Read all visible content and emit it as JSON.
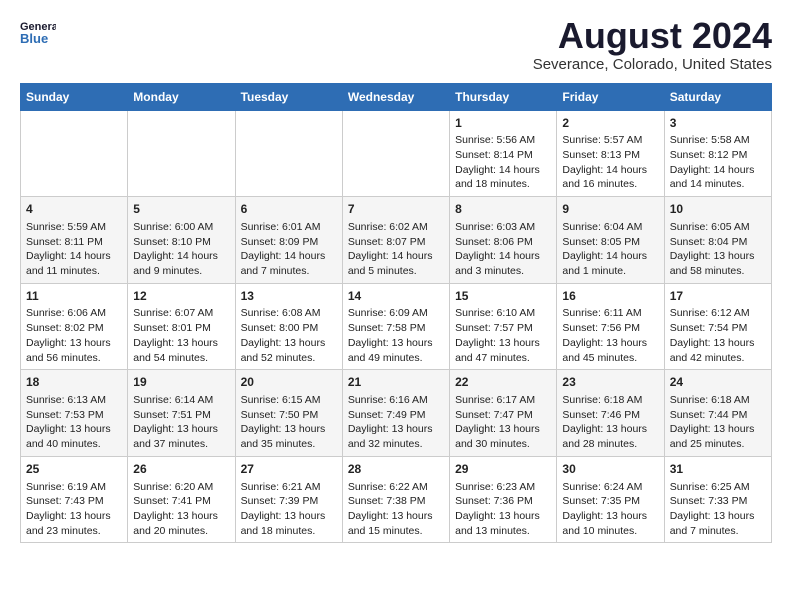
{
  "logo": {
    "line1": "General",
    "line2": "Blue"
  },
  "title": "August 2024",
  "subtitle": "Severance, Colorado, United States",
  "weekdays": [
    "Sunday",
    "Monday",
    "Tuesday",
    "Wednesday",
    "Thursday",
    "Friday",
    "Saturday"
  ],
  "weeks": [
    [
      {
        "day": "",
        "info": ""
      },
      {
        "day": "",
        "info": ""
      },
      {
        "day": "",
        "info": ""
      },
      {
        "day": "",
        "info": ""
      },
      {
        "day": "1",
        "info": "Sunrise: 5:56 AM\nSunset: 8:14 PM\nDaylight: 14 hours\nand 18 minutes."
      },
      {
        "day": "2",
        "info": "Sunrise: 5:57 AM\nSunset: 8:13 PM\nDaylight: 14 hours\nand 16 minutes."
      },
      {
        "day": "3",
        "info": "Sunrise: 5:58 AM\nSunset: 8:12 PM\nDaylight: 14 hours\nand 14 minutes."
      }
    ],
    [
      {
        "day": "4",
        "info": "Sunrise: 5:59 AM\nSunset: 8:11 PM\nDaylight: 14 hours\nand 11 minutes."
      },
      {
        "day": "5",
        "info": "Sunrise: 6:00 AM\nSunset: 8:10 PM\nDaylight: 14 hours\nand 9 minutes."
      },
      {
        "day": "6",
        "info": "Sunrise: 6:01 AM\nSunset: 8:09 PM\nDaylight: 14 hours\nand 7 minutes."
      },
      {
        "day": "7",
        "info": "Sunrise: 6:02 AM\nSunset: 8:07 PM\nDaylight: 14 hours\nand 5 minutes."
      },
      {
        "day": "8",
        "info": "Sunrise: 6:03 AM\nSunset: 8:06 PM\nDaylight: 14 hours\nand 3 minutes."
      },
      {
        "day": "9",
        "info": "Sunrise: 6:04 AM\nSunset: 8:05 PM\nDaylight: 14 hours\nand 1 minute."
      },
      {
        "day": "10",
        "info": "Sunrise: 6:05 AM\nSunset: 8:04 PM\nDaylight: 13 hours\nand 58 minutes."
      }
    ],
    [
      {
        "day": "11",
        "info": "Sunrise: 6:06 AM\nSunset: 8:02 PM\nDaylight: 13 hours\nand 56 minutes."
      },
      {
        "day": "12",
        "info": "Sunrise: 6:07 AM\nSunset: 8:01 PM\nDaylight: 13 hours\nand 54 minutes."
      },
      {
        "day": "13",
        "info": "Sunrise: 6:08 AM\nSunset: 8:00 PM\nDaylight: 13 hours\nand 52 minutes."
      },
      {
        "day": "14",
        "info": "Sunrise: 6:09 AM\nSunset: 7:58 PM\nDaylight: 13 hours\nand 49 minutes."
      },
      {
        "day": "15",
        "info": "Sunrise: 6:10 AM\nSunset: 7:57 PM\nDaylight: 13 hours\nand 47 minutes."
      },
      {
        "day": "16",
        "info": "Sunrise: 6:11 AM\nSunset: 7:56 PM\nDaylight: 13 hours\nand 45 minutes."
      },
      {
        "day": "17",
        "info": "Sunrise: 6:12 AM\nSunset: 7:54 PM\nDaylight: 13 hours\nand 42 minutes."
      }
    ],
    [
      {
        "day": "18",
        "info": "Sunrise: 6:13 AM\nSunset: 7:53 PM\nDaylight: 13 hours\nand 40 minutes."
      },
      {
        "day": "19",
        "info": "Sunrise: 6:14 AM\nSunset: 7:51 PM\nDaylight: 13 hours\nand 37 minutes."
      },
      {
        "day": "20",
        "info": "Sunrise: 6:15 AM\nSunset: 7:50 PM\nDaylight: 13 hours\nand 35 minutes."
      },
      {
        "day": "21",
        "info": "Sunrise: 6:16 AM\nSunset: 7:49 PM\nDaylight: 13 hours\nand 32 minutes."
      },
      {
        "day": "22",
        "info": "Sunrise: 6:17 AM\nSunset: 7:47 PM\nDaylight: 13 hours\nand 30 minutes."
      },
      {
        "day": "23",
        "info": "Sunrise: 6:18 AM\nSunset: 7:46 PM\nDaylight: 13 hours\nand 28 minutes."
      },
      {
        "day": "24",
        "info": "Sunrise: 6:18 AM\nSunset: 7:44 PM\nDaylight: 13 hours\nand 25 minutes."
      }
    ],
    [
      {
        "day": "25",
        "info": "Sunrise: 6:19 AM\nSunset: 7:43 PM\nDaylight: 13 hours\nand 23 minutes."
      },
      {
        "day": "26",
        "info": "Sunrise: 6:20 AM\nSunset: 7:41 PM\nDaylight: 13 hours\nand 20 minutes."
      },
      {
        "day": "27",
        "info": "Sunrise: 6:21 AM\nSunset: 7:39 PM\nDaylight: 13 hours\nand 18 minutes."
      },
      {
        "day": "28",
        "info": "Sunrise: 6:22 AM\nSunset: 7:38 PM\nDaylight: 13 hours\nand 15 minutes."
      },
      {
        "day": "29",
        "info": "Sunrise: 6:23 AM\nSunset: 7:36 PM\nDaylight: 13 hours\nand 13 minutes."
      },
      {
        "day": "30",
        "info": "Sunrise: 6:24 AM\nSunset: 7:35 PM\nDaylight: 13 hours\nand 10 minutes."
      },
      {
        "day": "31",
        "info": "Sunrise: 6:25 AM\nSunset: 7:33 PM\nDaylight: 13 hours\nand 7 minutes."
      }
    ]
  ]
}
